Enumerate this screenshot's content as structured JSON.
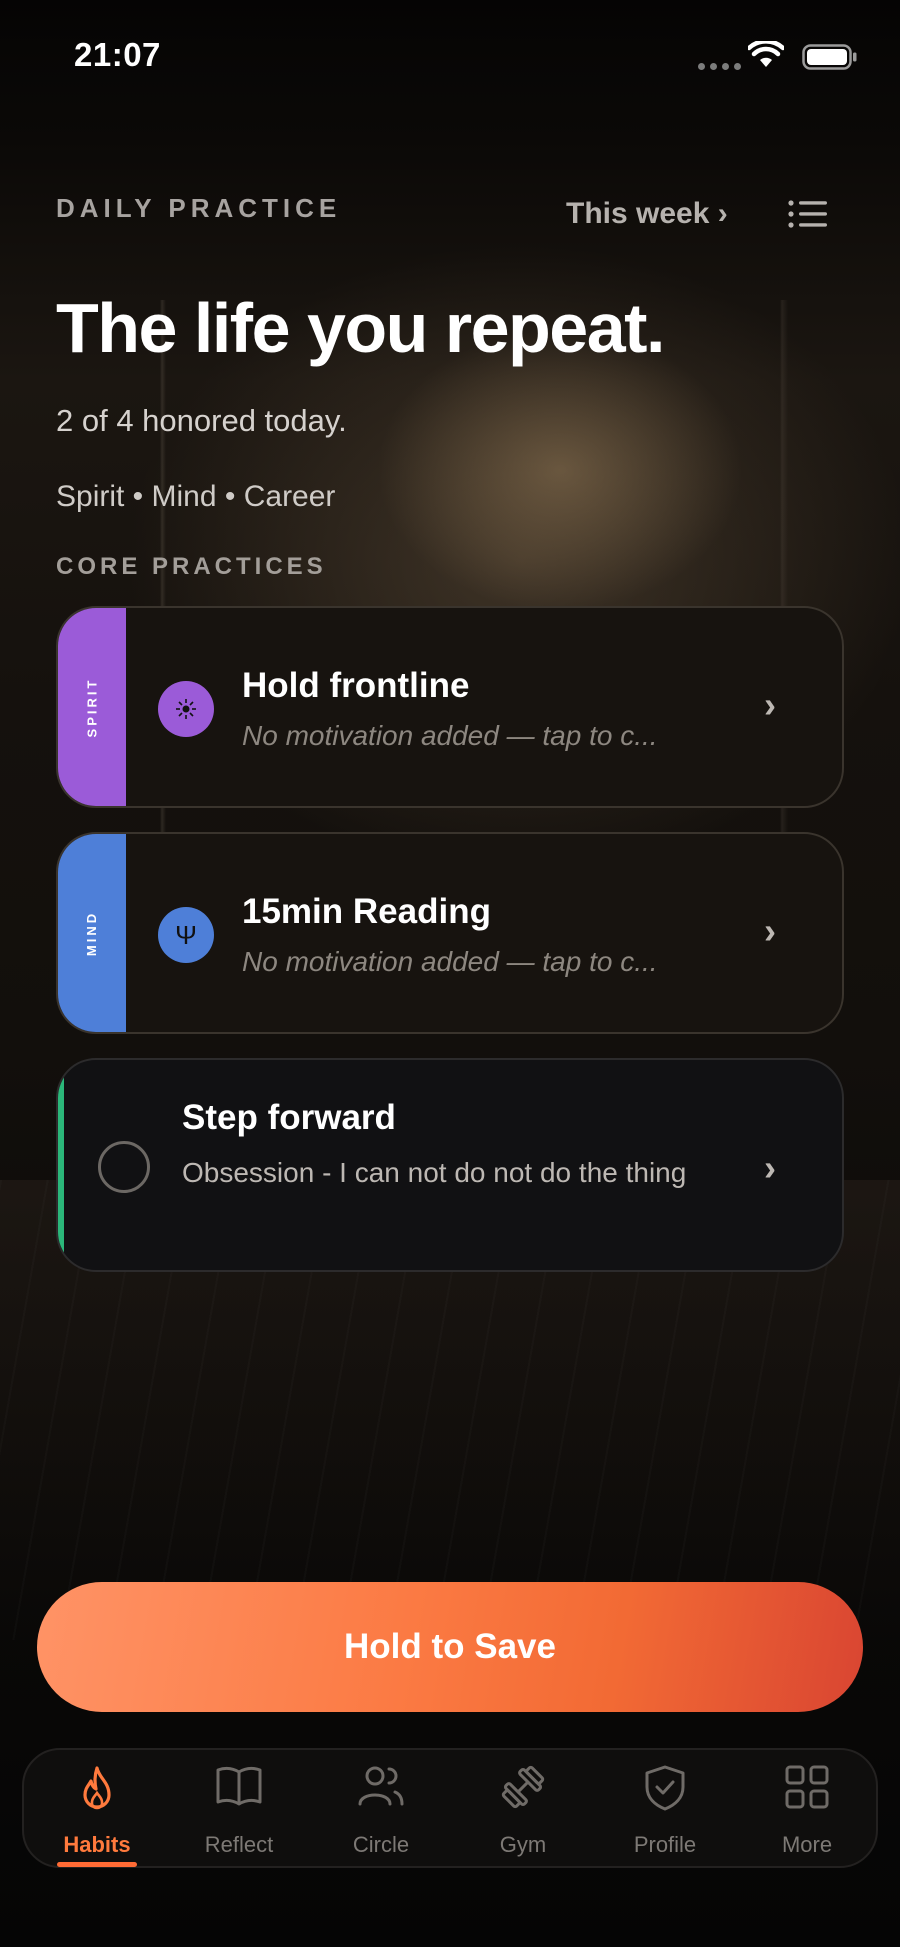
{
  "status_bar": {
    "time": "21:07"
  },
  "header": {
    "eyebrow": "DAILY PRACTICE",
    "week_link": "This week ›",
    "title": "The life you repeat.",
    "subtitle": "2 of 4 honored today.",
    "categories": "Spirit • Mind • Career"
  },
  "section": {
    "label": "CORE PRACTICES"
  },
  "practices": [
    {
      "band": "SPIRIT",
      "band_color": "#9b5bd8",
      "icon": "sun-burst-icon",
      "icon_glyph": "☀",
      "icon_bg": "#9b5bd8",
      "title": "Hold frontline",
      "subtitle": "No motivation added — tap to c..."
    },
    {
      "band": "MIND",
      "band_color": "#4e7fd8",
      "icon": "psi-icon",
      "icon_glyph": "Ψ",
      "icon_bg": "#4e7fd8",
      "title": "15min Reading",
      "subtitle": "No motivation added — tap to c..."
    },
    {
      "accent_color": "#2bb77a",
      "title": "Step forward",
      "body": "Obsession - I can not do not do the thing"
    }
  ],
  "save_button": {
    "label": "Hold to Save",
    "gradient_start": "#ff9366",
    "gradient_end": "#d94532"
  },
  "tabs": [
    {
      "label": "Habits",
      "icon": "flame-icon",
      "active": true
    },
    {
      "label": "Reflect",
      "icon": "book-icon",
      "active": false
    },
    {
      "label": "Circle",
      "icon": "people-icon",
      "active": false
    },
    {
      "label": "Gym",
      "icon": "dumbbell-icon",
      "active": false
    },
    {
      "label": "Profile",
      "icon": "shield-icon",
      "active": false
    },
    {
      "label": "More",
      "icon": "grid-icon",
      "active": false
    }
  ],
  "colors": {
    "accent": "#ff6b35",
    "background": "#060504"
  }
}
